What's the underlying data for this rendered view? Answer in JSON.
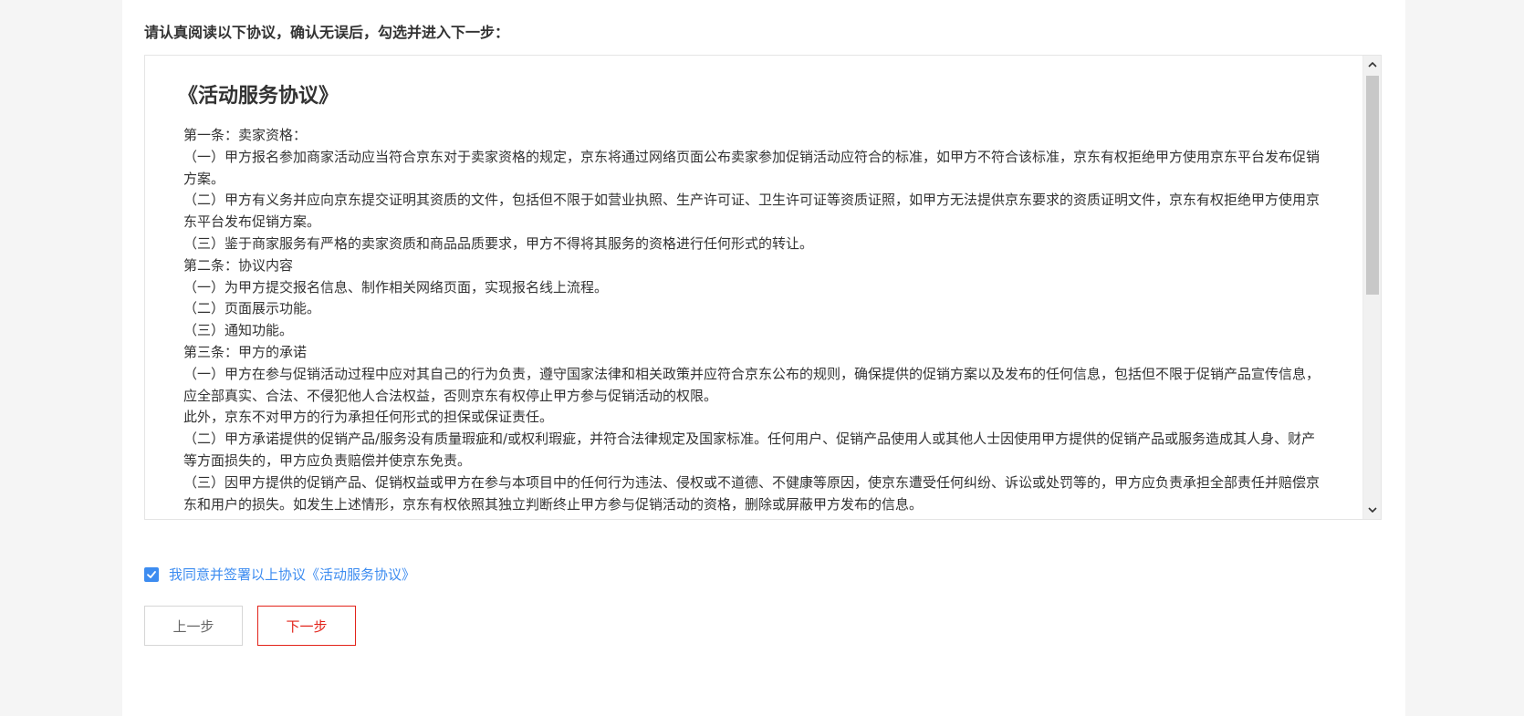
{
  "instruction": "请认真阅读以下协议，确认无误后，勾选并进入下一步：",
  "agreement": {
    "title": "《活动服务协议》",
    "lines": [
      "第一条：卖家资格：",
      "（一）甲方报名参加商家活动应当符合京东对于卖家资格的规定，京东将通过网络页面公布卖家参加促销活动应符合的标准，如甲方不符合该标准，京东有权拒绝甲方使用京东平台发布促销方案。",
      "（二）甲方有义务并应向京东提交证明其资质的文件，包括但不限于如营业执照、生产许可证、卫生许可证等资质证照，如甲方无法提供京东要求的资质证明文件，京东有权拒绝甲方使用京东平台发布促销方案。",
      "（三）鉴于商家服务有严格的卖家资质和商品品质要求，甲方不得将其服务的资格进行任何形式的转让。",
      "第二条：协议内容",
      "（一）为甲方提交报名信息、制作相关网络页面，实现报名线上流程。",
      "（二）页面展示功能。",
      "（三）通知功能。",
      "第三条：甲方的承诺",
      "（一）甲方在参与促销活动过程中应对其自己的行为负责，遵守国家法律和相关政策并应符合京东公布的规则，确保提供的促销方案以及发布的任何信息，包括但不限于促销产品宣传信息，应全部真实、合法、不侵犯他人合法权益，否则京东有权停止甲方参与促销活动的权限。",
      "此外，京东不对甲方的行为承担任何形式的担保或保证责任。",
      "（二）甲方承诺提供的促销产品/服务没有质量瑕疵和/或权利瑕疵，并符合法律规定及国家标准。任何用户、促销产品使用人或其他人士因使用甲方提供的促销产品或服务造成其人身、财产等方面损失的，甲方应负责赔偿并使京东免责。",
      "（三）因甲方提供的促销产品、促销权益或甲方在参与本项目中的任何行为违法、侵权或不道德、不健康等原因，使京东遭受任何纠纷、诉讼或处罚等的，甲方应负责承担全部责任并赔偿京东和用户的损失。如发生上述情形，京东有权依照其独立判断终止甲方参与促销活动的资格，删除或屏蔽甲方发布的信息。"
    ]
  },
  "agree": {
    "checked": true,
    "label": "我同意并签署以上协议《活动服务协议》"
  },
  "buttons": {
    "prev": "上一步",
    "next": "下一步"
  },
  "colors": {
    "accent_blue": "#3d8cf0",
    "accent_red": "#e2231a"
  },
  "icons": {
    "scroll_up": "chevron-up-icon",
    "scroll_down": "chevron-down-icon",
    "checkbox": "check-icon"
  }
}
